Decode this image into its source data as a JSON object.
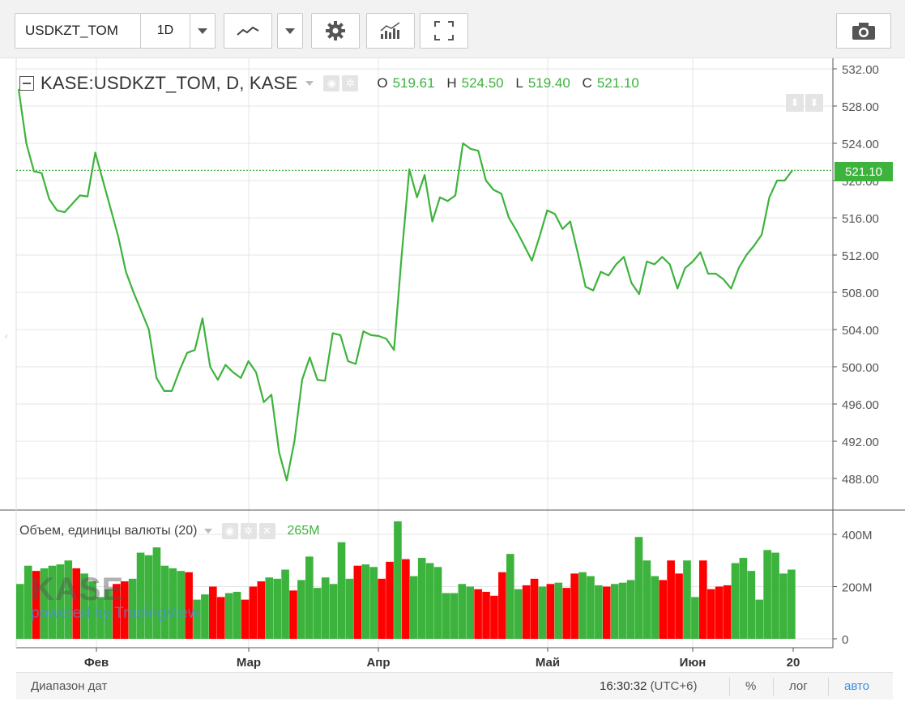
{
  "toolbar": {
    "symbol": "USDKZT_TOM",
    "interval": "1D",
    "chart_type_icon": "line-chart-icon",
    "settings_icon": "gear-icon",
    "indicators_icon": "indicators-icon",
    "fullscreen_icon": "fullscreen-icon",
    "snapshot_icon": "camera-icon"
  },
  "legend": {
    "title": "KASE:USDKZT_TOM, D, KASE",
    "o_label": "O",
    "o": "519.61",
    "h_label": "H",
    "h": "524.50",
    "l_label": "L",
    "l": "519.40",
    "c_label": "C",
    "c": "521.10"
  },
  "volume_legend": {
    "title": "Объем, единицы валюты (20)",
    "value": "265M"
  },
  "last_price_label": "521.10",
  "watermark": {
    "logo": "KASE",
    "powered": "powered by TradingView"
  },
  "bottombar": {
    "range": "Диапазон дат",
    "clock": "16:30:32",
    "tz": "(UTC+6)",
    "percent": "%",
    "log": "лог",
    "auto": "авто"
  },
  "colors": {
    "line": "#3cb33c",
    "up": "#3cb33c",
    "down": "#ff0000",
    "grid": "#e6e6e6",
    "axis": "#555555"
  },
  "chart_data": [
    {
      "type": "line",
      "title": "KASE:USDKZT_TOM, D, KASE",
      "x_labels": [
        "Фев",
        "Мар",
        "Апр",
        "Май",
        "Июн",
        "20"
      ],
      "y_ticks": [
        "488.00",
        "492.00",
        "496.00",
        "500.00",
        "504.00",
        "508.00",
        "512.00",
        "516.00",
        "520.00",
        "524.00",
        "528.00",
        "532.00"
      ],
      "ylim": [
        485,
        533
      ],
      "grid": true,
      "values": [
        529.8,
        524.0,
        521.0,
        520.8,
        518.0,
        516.8,
        516.6,
        517.5,
        518.4,
        518.3,
        523.0,
        520.0,
        517.0,
        514.0,
        510.2,
        508.0,
        506.0,
        504.0,
        498.8,
        497.4,
        497.4,
        499.6,
        501.5,
        501.8,
        505.2,
        500.0,
        498.6,
        500.2,
        499.4,
        498.8,
        500.6,
        499.4,
        496.2,
        497.0,
        490.8,
        487.8,
        492.0,
        498.6,
        501.0,
        498.6,
        498.5,
        503.6,
        503.4,
        500.6,
        500.3,
        503.8,
        503.4,
        503.3,
        503.0,
        501.8,
        512.0,
        521.2,
        518.2,
        520.6,
        515.6,
        518.2,
        517.8,
        518.4,
        524.0,
        523.4,
        523.2,
        520.0,
        519.0,
        518.6,
        516.0,
        514.6,
        513.0,
        511.4,
        514.0,
        516.8,
        516.4,
        514.8,
        515.6,
        512.2,
        508.6,
        508.2,
        510.2,
        509.8,
        511.0,
        511.8,
        509.0,
        507.8,
        511.3,
        511.0,
        511.8,
        511.0,
        508.4,
        510.6,
        511.3,
        512.3,
        510.0,
        510.0,
        509.4,
        508.4,
        510.6,
        512.0,
        513.0,
        514.2,
        518.2,
        520.0,
        520.0,
        521.1
      ],
      "last_value": 521.1
    },
    {
      "type": "bar",
      "title": "Объем, единицы валюты (20)",
      "y_ticks": [
        "0",
        "200M",
        "400M"
      ],
      "ylim": [
        0,
        460
      ],
      "values": [
        210,
        280,
        260,
        270,
        280,
        285,
        300,
        270,
        250,
        220,
        160,
        190,
        210,
        220,
        230,
        330,
        320,
        350,
        280,
        270,
        260,
        255,
        150,
        170,
        200,
        160,
        175,
        180,
        150,
        200,
        220,
        235,
        230,
        265,
        185,
        225,
        315,
        195,
        235,
        210,
        370,
        230,
        280,
        285,
        275,
        230,
        295,
        450,
        305,
        240,
        310,
        290,
        275,
        175,
        175,
        210,
        200,
        190,
        180,
        165,
        255,
        325,
        190,
        205,
        230,
        200,
        210,
        215,
        195,
        250,
        255,
        240,
        205,
        200,
        210,
        215,
        225,
        390,
        300,
        240,
        225,
        300,
        250,
        300,
        160,
        300,
        190,
        200,
        205,
        290,
        310,
        260,
        150,
        340,
        330,
        250,
        265
      ],
      "up": [
        1,
        1,
        0,
        1,
        1,
        1,
        1,
        0,
        1,
        1,
        1,
        1,
        0,
        0,
        1,
        1,
        1,
        1,
        1,
        1,
        1,
        0,
        1,
        1,
        0,
        0,
        1,
        1,
        0,
        0,
        0,
        1,
        1,
        1,
        0,
        1,
        1,
        1,
        1,
        1,
        1,
        1,
        0,
        1,
        1,
        0,
        0,
        1,
        0,
        1,
        1,
        1,
        1,
        1,
        1,
        1,
        1,
        0,
        0,
        0,
        0,
        1,
        1,
        0,
        0,
        1,
        0,
        1,
        0,
        0,
        1,
        1,
        1,
        0,
        1,
        1,
        1,
        1,
        1,
        1,
        0,
        0,
        0,
        1,
        1,
        0,
        0,
        0,
        0,
        1,
        1,
        1,
        1,
        1,
        1,
        1,
        1
      ],
      "last_value": "265M"
    }
  ]
}
